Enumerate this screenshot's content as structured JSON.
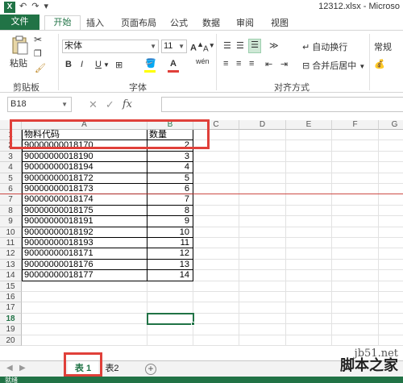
{
  "titlebar": {
    "app_icon": "X",
    "qat": [
      "↶",
      "↷",
      "▾"
    ],
    "title": "12312.xlsx - Microso"
  },
  "ribbon_tabs": [
    "文件",
    "开始",
    "插入",
    "页面布局",
    "公式",
    "数据",
    "审阅",
    "视图"
  ],
  "ribbon": {
    "paste": "粘贴",
    "clipboard": "剪贴板",
    "font_group": "字体",
    "align_group": "对齐方式",
    "font_name": "宋体",
    "font_size": "11",
    "bold": "B",
    "italic": "I",
    "underline": "U",
    "wrap_text": "自动换行",
    "merge_center": "合并后居中",
    "number_format": "常规",
    "wen": "wén"
  },
  "namebox": "B18",
  "fx": "fx",
  "columns": [
    "A",
    "B",
    "C",
    "D",
    "E",
    "F",
    "G"
  ],
  "rows": [
    "1",
    "2",
    "3",
    "4",
    "5",
    "6",
    "7",
    "8",
    "9",
    "10",
    "11",
    "12",
    "13",
    "14",
    "15",
    "16",
    "17",
    "18",
    "19",
    "20"
  ],
  "header": {
    "a": "物料代码",
    "b": "数量"
  },
  "data": [
    {
      "code": "90000000018170",
      "qty": "2"
    },
    {
      "code": "90000000018190",
      "qty": "3"
    },
    {
      "code": "90000000018194",
      "qty": "4"
    },
    {
      "code": "90000000018172",
      "qty": "5"
    },
    {
      "code": "90000000018173",
      "qty": "6"
    },
    {
      "code": "90000000018174",
      "qty": "7"
    },
    {
      "code": "90000000018175",
      "qty": "8"
    },
    {
      "code": "90000000018191",
      "qty": "9"
    },
    {
      "code": "90000000018192",
      "qty": "10"
    },
    {
      "code": "90000000018193",
      "qty": "11"
    },
    {
      "code": "90000000018171",
      "qty": "12"
    },
    {
      "code": "90000000018176",
      "qty": "13"
    },
    {
      "code": "90000000018177",
      "qty": "14"
    }
  ],
  "sheets": [
    "表 1",
    "表2"
  ],
  "status": "就绪",
  "watermark": {
    "line1": "jb51.net",
    "line2": "脚本之家"
  },
  "colors": {
    "excel_green": "#217346",
    "annotation_red": "#e0403a"
  }
}
